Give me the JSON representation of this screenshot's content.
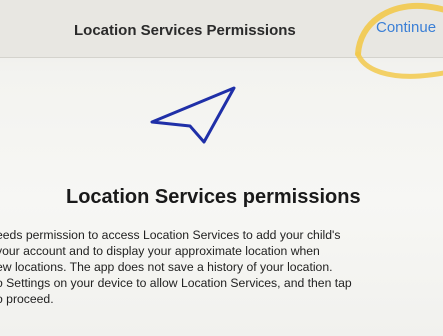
{
  "nav": {
    "title": "Location Services Permissions",
    "continue_label": "Continue"
  },
  "icons": {
    "location": "location-arrow-icon"
  },
  "content": {
    "heading": "Location Services permissions",
    "lines": [
      "eeds permission to access Location Services to add your child's",
      "your account and to display your approximate location when",
      "ew locations. The app does not save a history of your location.",
      "o Settings on your device to allow Location Services, and then tap",
      "o proceed."
    ]
  },
  "colors": {
    "accent": "#3a7fd6",
    "icon_stroke": "#1f2fa8",
    "highlight": "#f2c94c"
  }
}
